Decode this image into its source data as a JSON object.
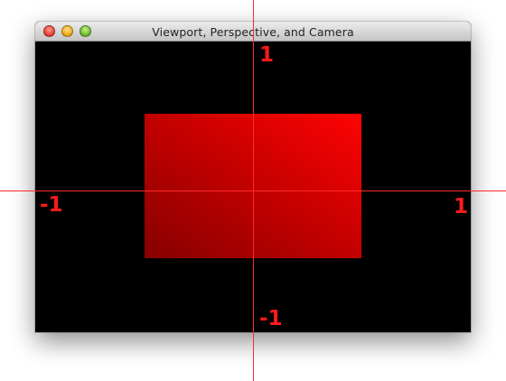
{
  "window": {
    "title": "Viewport, Perspective, and Camera",
    "buttons": {
      "close": "close",
      "minimize": "minimize",
      "zoom": "zoom"
    }
  },
  "viewport": {
    "background": "#000000",
    "quad_gradient": [
      "#860000",
      "#c20000",
      "#ff0303"
    ]
  },
  "axes": {
    "color": "#ff2a2a",
    "label_top": "1",
    "label_bottom": "-1",
    "label_left": "-1",
    "label_right": "1"
  }
}
